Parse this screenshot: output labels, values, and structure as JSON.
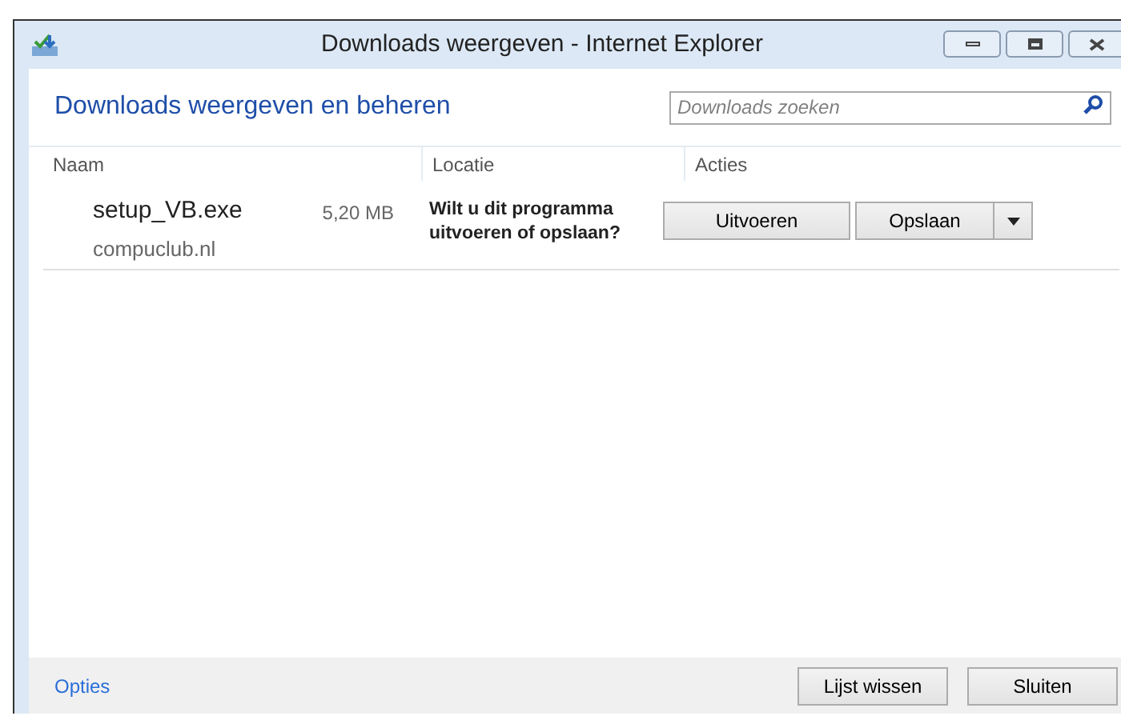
{
  "window": {
    "title": "Downloads weergeven - Internet Explorer"
  },
  "heading": "Downloads weergeven en beheren",
  "search": {
    "placeholder": "Downloads zoeken"
  },
  "columns": [
    "Naam",
    "Locatie",
    "Acties"
  ],
  "downloads": [
    {
      "name": "setup_VB.exe",
      "size": "5,20 MB",
      "source": "compuclub.nl",
      "message": "Wilt u dit programma uitvoeren of opslaan?",
      "run_label": "Uitvoeren",
      "save_label": "Opslaan"
    }
  ],
  "footer": {
    "link": "Opties",
    "buttons": [
      "Lijst wissen",
      "Sluiten"
    ]
  }
}
